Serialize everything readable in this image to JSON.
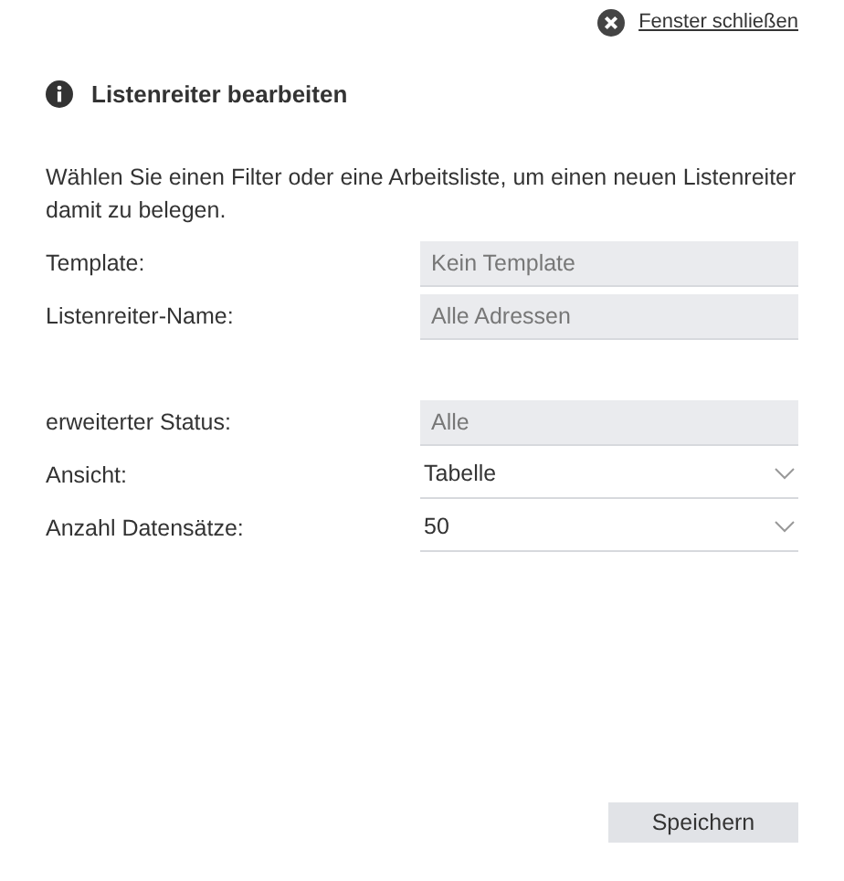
{
  "close_link": {
    "label": "Fenster schließen"
  },
  "title": "Listenreiter bearbeiten",
  "description": "Wählen Sie einen Filter oder eine Arbeitsliste, um einen neuen Listenreiter damit zu belegen.",
  "fields": [
    {
      "label": "Template:",
      "kind": "input",
      "value": "Kein Template",
      "disabled": true
    },
    {
      "label": "Listenreiter-Name:",
      "kind": "input",
      "value": "Alle Adressen",
      "disabled": true
    },
    {
      "kind": "spacer"
    },
    {
      "label": "erweiterter Status:",
      "kind": "input",
      "value": "Alle",
      "disabled": true
    },
    {
      "label": "Ansicht:",
      "kind": "select",
      "value": "Tabelle",
      "disabled": false
    },
    {
      "label": "Anzahl Datensätze:",
      "kind": "select",
      "value": "50",
      "disabled": false
    }
  ],
  "buttons": [
    "Speichern"
  ]
}
